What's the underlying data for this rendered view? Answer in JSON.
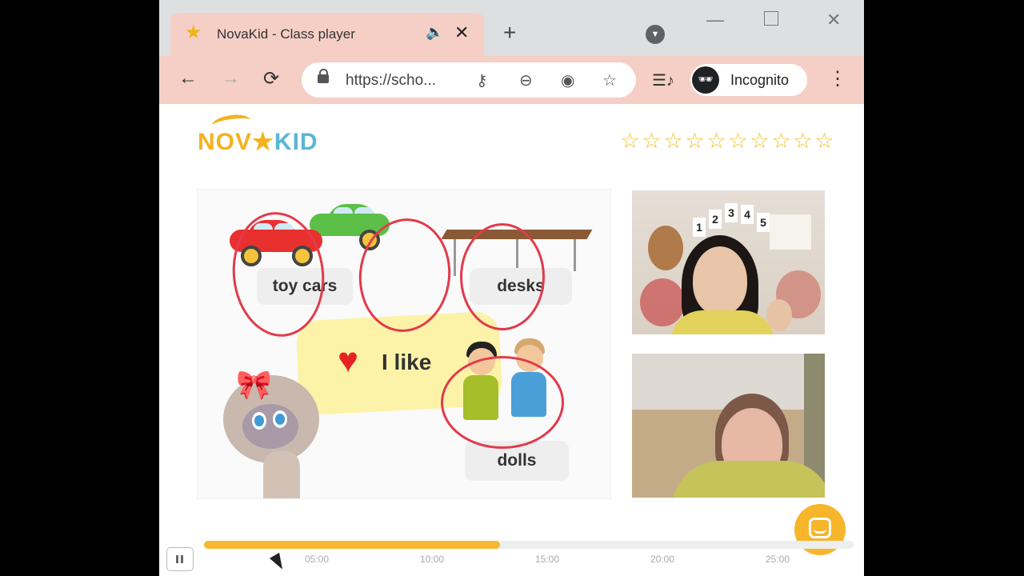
{
  "browser": {
    "tab": {
      "title": "NovaKid - Class player",
      "favicon": "star-icon",
      "audio_icon": "speaker-icon",
      "close_glyph": "✕"
    },
    "new_tab_glyph": "+",
    "url": "https://scho...",
    "incognito_label": "Incognito",
    "icons": [
      "back-icon",
      "forward-icon",
      "reload-icon",
      "lock-icon",
      "key-icon",
      "zoom-out-icon",
      "eye-slash-icon",
      "star-bookmark-icon",
      "media-icon",
      "incognito-icon",
      "menu-icon"
    ]
  },
  "app": {
    "logo": {
      "part1": "NOV",
      "part2": "KID"
    },
    "star_rating": {
      "earned": 0,
      "total": 10
    },
    "slide": {
      "words": {
        "toy_cars": "toy cars",
        "desks": "desks",
        "dolls": "dolls"
      },
      "i_like": "I like"
    },
    "player": {
      "progress_fraction": 0.456,
      "ticks": [
        "05:00",
        "10:00",
        "15:00",
        "20:00",
        "25:00"
      ]
    }
  },
  "colors": {
    "tab_bg": "#f5cfc5",
    "accent": "#f5b21f",
    "star": "#f2c12e",
    "progress": "#f5b92e",
    "annotation": "#e33a4a"
  }
}
